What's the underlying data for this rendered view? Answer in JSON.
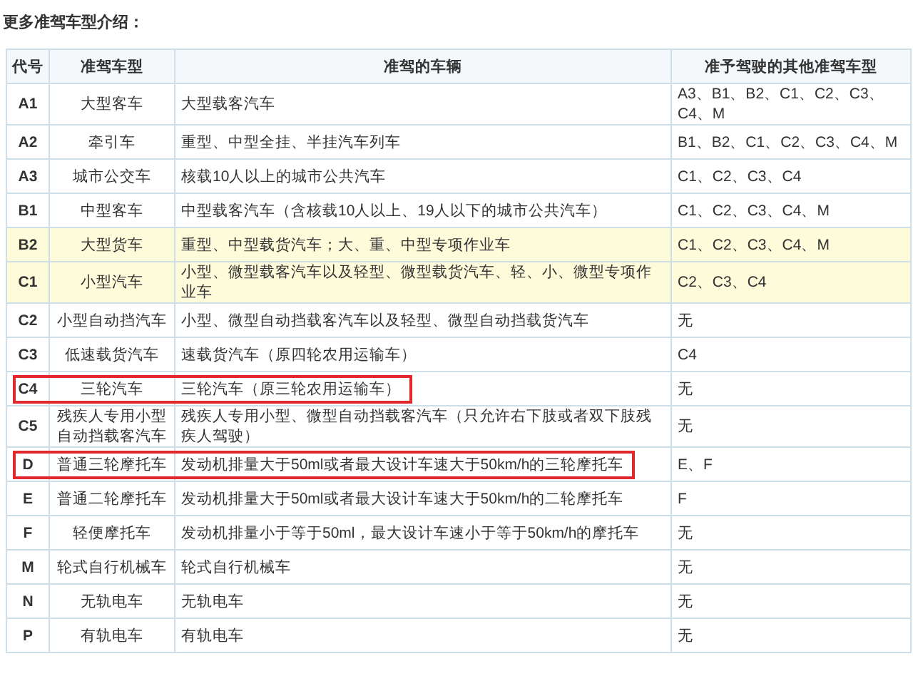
{
  "title": "更多准驾车型介绍：",
  "table": {
    "columns": [
      "代号",
      "准驾车型",
      "准驾的车辆",
      "准予驾驶的其他准驾车型"
    ],
    "rows": [
      {
        "code": "A1",
        "type": "大型客车",
        "vehicles": "大型载客汽车",
        "also": "A3、B1、B2、C1、C2、C3、C4、M",
        "highlighted": false,
        "boxed": false
      },
      {
        "code": "A2",
        "type": "牵引车",
        "vehicles": "重型、中型全挂、半挂汽车列车",
        "also": "B1、B2、C1、C2、C3、C4、M",
        "highlighted": false,
        "boxed": false
      },
      {
        "code": "A3",
        "type": "城市公交车",
        "vehicles": "核载10人以上的城市公共汽车",
        "also": "C1、C2、C3、C4",
        "highlighted": false,
        "boxed": false
      },
      {
        "code": "B1",
        "type": "中型客车",
        "vehicles": "中型载客汽车（含核载10人以上、19人以下的城市公共汽车）",
        "also": "C1、C2、C3、C4、M",
        "highlighted": false,
        "boxed": false
      },
      {
        "code": "B2",
        "type": "大型货车",
        "vehicles": "重型、中型载货汽车；大、重、中型专项作业车",
        "also": "C1、C2、C3、C4、M",
        "highlighted": true,
        "boxed": false
      },
      {
        "code": "C1",
        "type": "小型汽车",
        "vehicles": "小型、微型载客汽车以及轻型、微型载货汽车、轻、小、微型专项作业车",
        "also": "C2、C3、C4",
        "highlighted": true,
        "boxed": false
      },
      {
        "code": "C2",
        "type": "小型自动挡汽车",
        "vehicles": "小型、微型自动挡载客汽车以及轻型、微型自动挡载货汽车",
        "also": "无",
        "highlighted": false,
        "boxed": false
      },
      {
        "code": "C3",
        "type": "低速载货汽车",
        "vehicles": "速载货汽车（原四轮农用运输车）",
        "also": "C4",
        "highlighted": false,
        "boxed": false
      },
      {
        "code": "C4",
        "type": "三轮汽车",
        "vehicles": "三轮汽车（原三轮农用运输车）",
        "also": "无",
        "highlighted": false,
        "boxed": true
      },
      {
        "code": "C5",
        "type": "残疾人专用小型自动挡载客汽车",
        "vehicles": "残疾人专用小型、微型自动挡载客汽车（只允许右下肢或者双下肢残疾人驾驶）",
        "also": "无",
        "highlighted": false,
        "boxed": false
      },
      {
        "code": "D",
        "type": "普通三轮摩托车",
        "vehicles": "发动机排量大于50ml或者最大设计车速大于50km/h的三轮摩托车",
        "also": "E、F",
        "highlighted": false,
        "boxed": true
      },
      {
        "code": "E",
        "type": "普通二轮摩托车",
        "vehicles": "发动机排量大于50ml或者最大设计车速大于50km/h的二轮摩托车",
        "also": "F",
        "highlighted": false,
        "boxed": false
      },
      {
        "code": "F",
        "type": "轻便摩托车",
        "vehicles": "发动机排量小于等于50ml，最大设计车速小于等于50km/h的摩托车",
        "also": "无",
        "highlighted": false,
        "boxed": false
      },
      {
        "code": "M",
        "type": "轮式自行机械车",
        "vehicles": "轮式自行机械车",
        "also": "无",
        "highlighted": false,
        "boxed": false
      },
      {
        "code": "N",
        "type": "无轨电车",
        "vehicles": "无轨电车",
        "also": "无",
        "highlighted": false,
        "boxed": false
      },
      {
        "code": "P",
        "type": "有轨电车",
        "vehicles": "有轨电车",
        "also": "无",
        "highlighted": false,
        "boxed": false
      }
    ]
  }
}
